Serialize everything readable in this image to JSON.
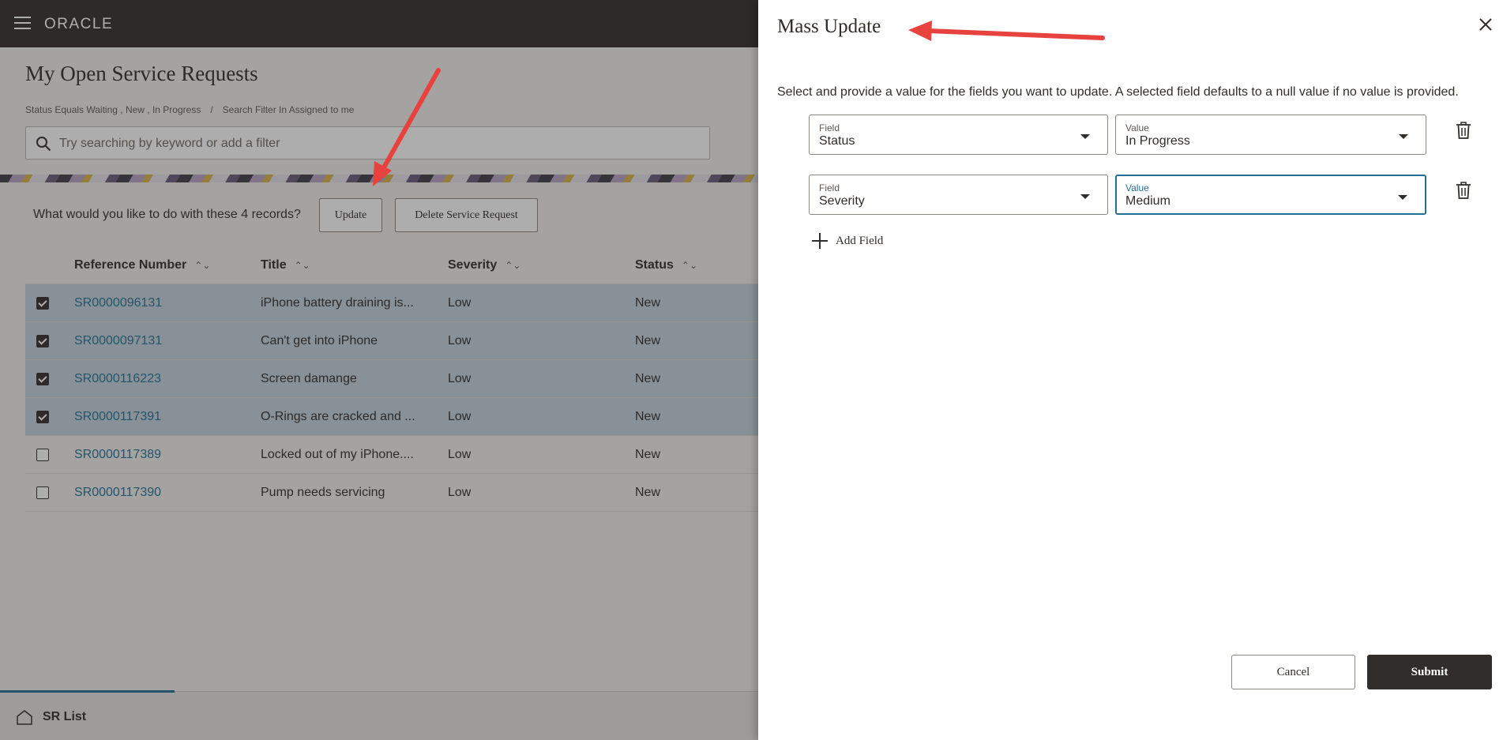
{
  "app": {
    "brand": "ORACLE",
    "page_title": "My Open Service Requests",
    "filters": [
      "Status Equals Waiting , New , In Progress",
      "Search Filter In Assigned to me"
    ],
    "filter_separator": "/",
    "search": {
      "placeholder": "Try searching by keyword or add a filter"
    },
    "action_prompt": "What would you like to do with these 4 records?",
    "update_label": "Update",
    "delete_label": "Delete Service Request",
    "table": {
      "columns": [
        "Reference Number",
        "Title",
        "Severity",
        "Status"
      ],
      "rows": [
        {
          "checked": true,
          "ref": "SR0000096131",
          "title": "iPhone battery draining is...",
          "severity": "Low",
          "status": "New"
        },
        {
          "checked": true,
          "ref": "SR0000097131",
          "title": "Can't get into iPhone",
          "severity": "Low",
          "status": "New"
        },
        {
          "checked": true,
          "ref": "SR0000116223",
          "title": "Screen damange",
          "severity": "Low",
          "status": "New"
        },
        {
          "checked": true,
          "ref": "SR0000117391",
          "title": "O-Rings are cracked and ...",
          "severity": "Low",
          "status": "New"
        },
        {
          "checked": false,
          "ref": "SR0000117389",
          "title": "Locked out of my iPhone....",
          "severity": "Low",
          "status": "New"
        },
        {
          "checked": false,
          "ref": "SR0000117390",
          "title": "Pump needs servicing",
          "severity": "Low",
          "status": "New"
        }
      ]
    },
    "footer_label": "SR List"
  },
  "drawer": {
    "title": "Mass Update",
    "instructions": "Select and provide a value for the fields you want to update. A selected field defaults to a null value if no value is provided.",
    "rows": [
      {
        "field_label": "Field",
        "field_value": "Status",
        "value_label": "Value",
        "value_value": "In Progress"
      },
      {
        "field_label": "Field",
        "field_value": "Severity",
        "value_label": "Value",
        "value_value": "Medium"
      }
    ],
    "add_field_label": "Add Field",
    "cancel_label": "Cancel",
    "submit_label": "Submit"
  },
  "colors": {
    "header_bg": "#312d2a",
    "link": "#227093",
    "selected_row": "#c4d2dc",
    "focus_border": "#227093",
    "annotation_arrow": "#e8423f"
  }
}
